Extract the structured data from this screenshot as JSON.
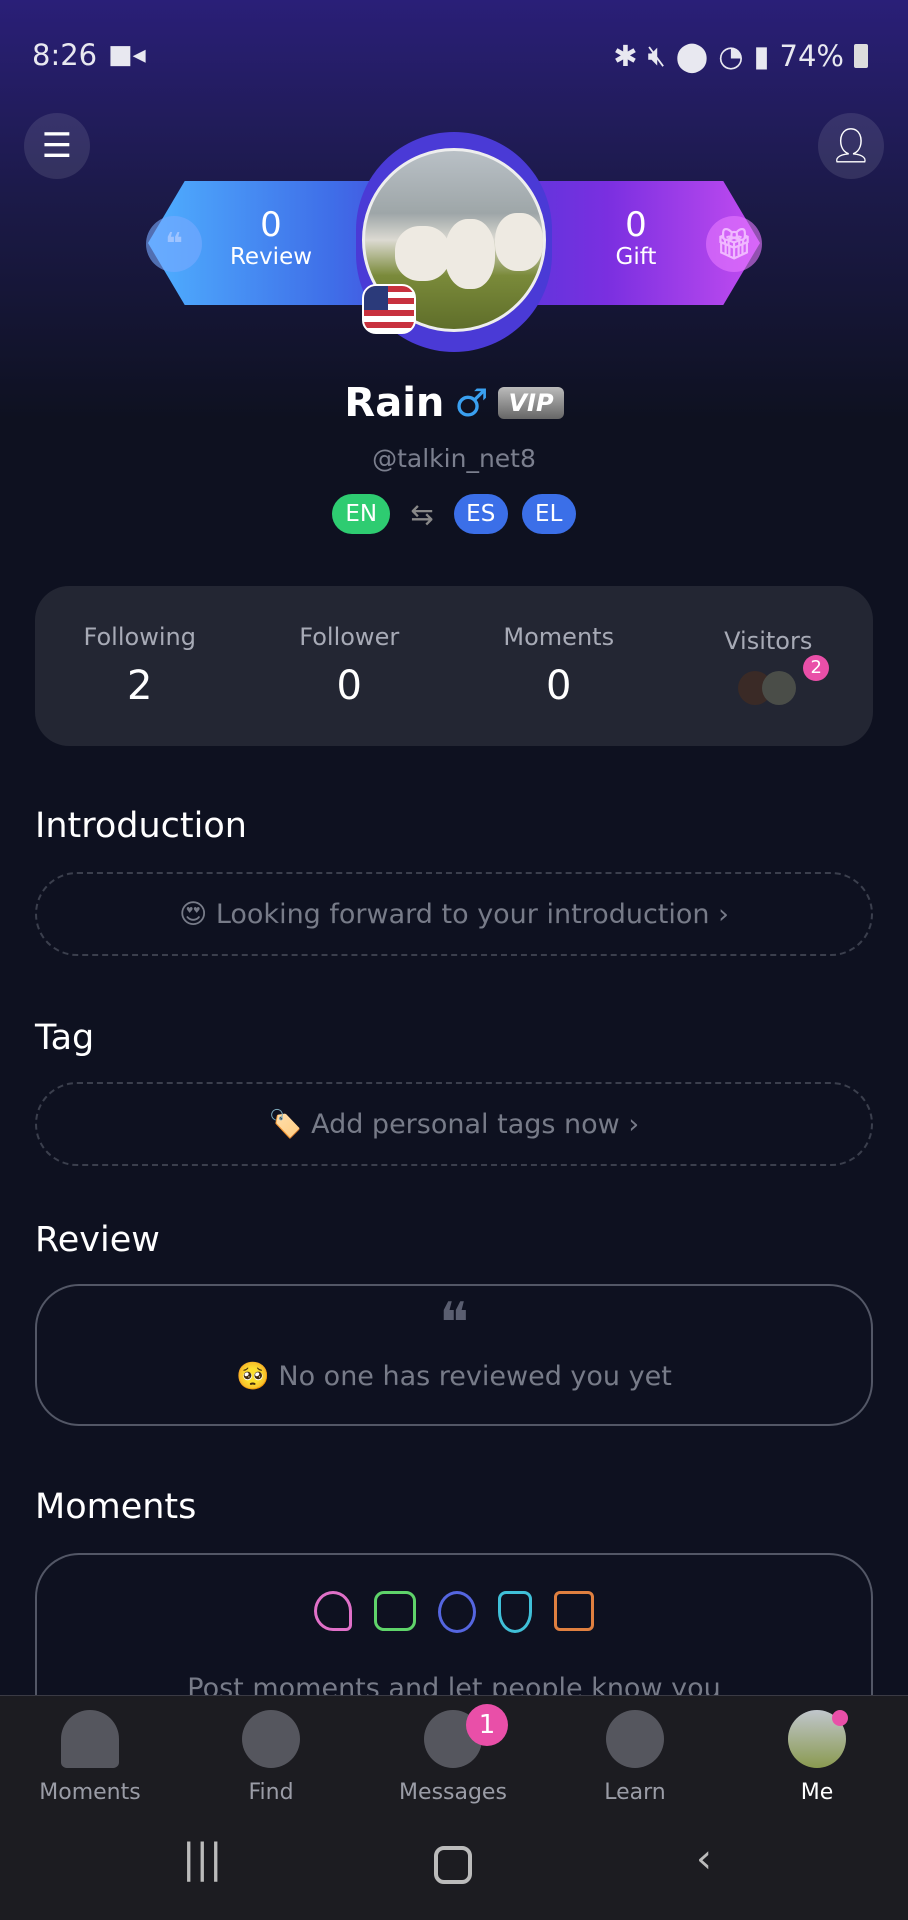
{
  "status_bar": {
    "time": "8:26",
    "battery": "74%",
    "icons": [
      "video-icon",
      "bluetooth-icon",
      "mute-icon",
      "location-icon",
      "wifi-icon",
      "signal-icon",
      "battery-icon"
    ]
  },
  "header": {
    "menu_icon": "menu-icon",
    "edit_icon": "edit-profile-icon"
  },
  "badges": {
    "review_count": "0",
    "review_label": "Review",
    "gift_count": "0",
    "gift_label": "Gift"
  },
  "profile": {
    "name": "Rain",
    "gender_symbol": "♂",
    "vip": "VIP",
    "handle": "@talkin_net8",
    "native": "EN",
    "learning": [
      "ES",
      "EL"
    ]
  },
  "stats": [
    {
      "label": "Following",
      "value": "2"
    },
    {
      "label": "Follower",
      "value": "0"
    },
    {
      "label": "Moments",
      "value": "0"
    },
    {
      "label": "Visitors",
      "badge": "2"
    }
  ],
  "introduction": {
    "title": "Introduction",
    "prompt": "😍 Looking forward to your introduction ›"
  },
  "tag": {
    "title": "Tag",
    "prompt": "🏷️ Add personal tags now ›"
  },
  "review": {
    "title": "Review",
    "empty": "🥺 No one has reviewed you yet"
  },
  "moments": {
    "title": "Moments",
    "empty": "Post moments and let people know you"
  },
  "bottom_nav": [
    {
      "label": "Moments"
    },
    {
      "label": "Find"
    },
    {
      "label": "Messages",
      "badge": "1"
    },
    {
      "label": "Learn"
    },
    {
      "label": "Me",
      "active": true
    }
  ],
  "colors": {
    "accent": "#e94fa8",
    "en": "#2ecc71",
    "lang": "#3b6fe8"
  }
}
